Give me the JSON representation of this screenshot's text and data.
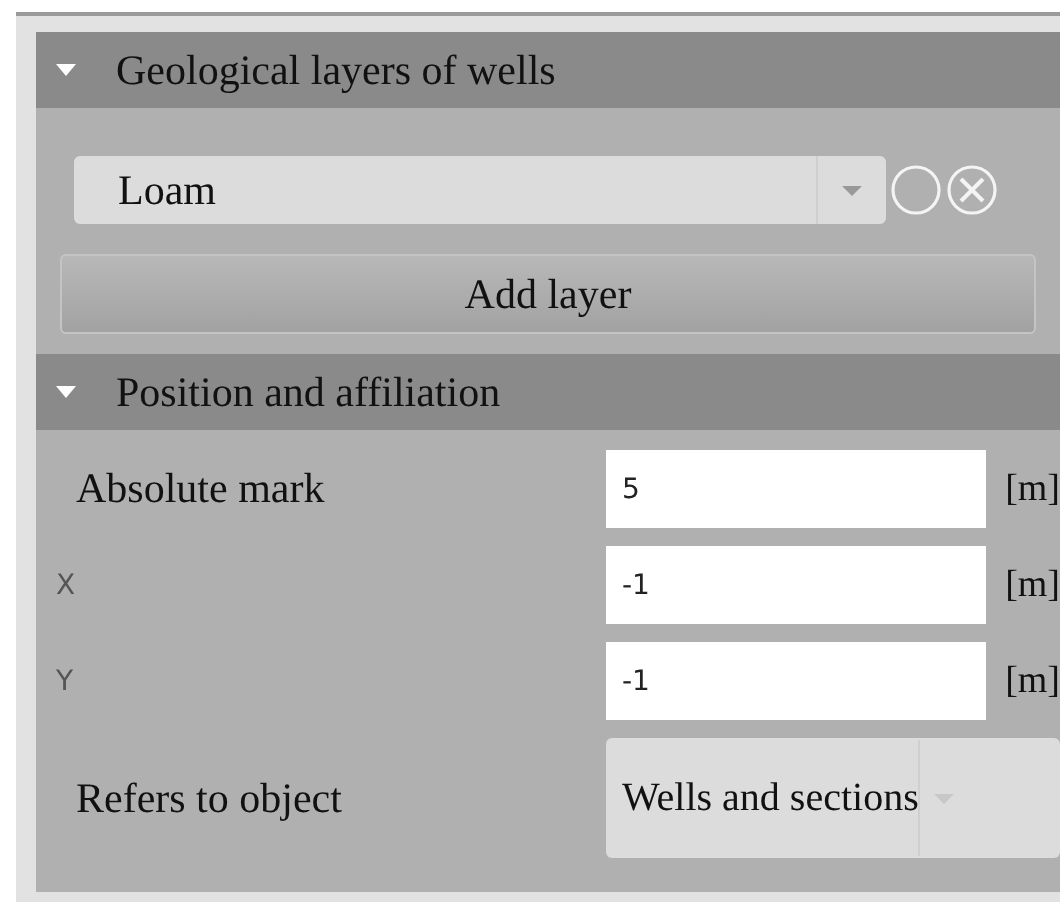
{
  "sections": [
    {
      "title": "Geological layers of wells",
      "expanded": true,
      "layer_select": {
        "value": "Loam"
      },
      "add_button": "Add layer"
    },
    {
      "title": "Position and affiliation",
      "expanded": true,
      "rows": [
        {
          "kind": "field",
          "label": "Absolute mark",
          "value": "5",
          "unit": "[m]"
        },
        {
          "kind": "coord",
          "label": "X",
          "value": "-1",
          "unit": "[m]"
        },
        {
          "kind": "coord",
          "label": "Y",
          "value": "-1",
          "unit": "[m]"
        },
        {
          "kind": "select",
          "label": "Refers to object",
          "value": "Wells and sections"
        }
      ]
    }
  ]
}
